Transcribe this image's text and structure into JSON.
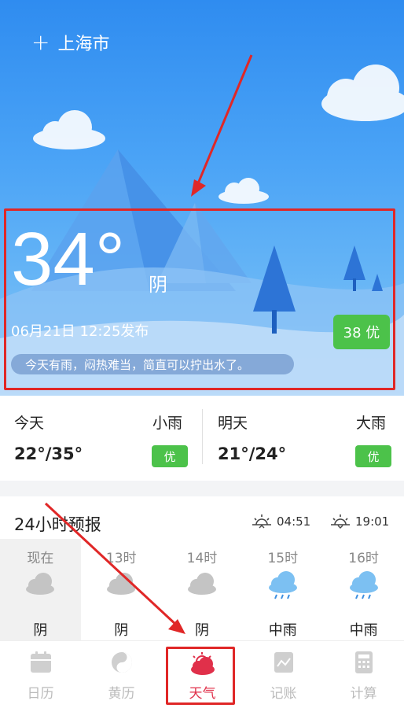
{
  "header": {
    "add_icon": "plus-icon",
    "city": "上海市"
  },
  "current": {
    "temperature": "34°",
    "condition": "阴",
    "published": "06月21日 12:25发布",
    "aqi": "38 优",
    "tip": "今天有雨，闷热难当，简直可以拧出水了。"
  },
  "days": [
    {
      "label": "今天",
      "weather": "小雨",
      "range": "22°/35°",
      "aqi": "优"
    },
    {
      "label": "明天",
      "weather": "大雨",
      "range": "21°/24°",
      "aqi": "优"
    }
  ],
  "hourly": {
    "title": "24小时预报",
    "sunrise": "04:51",
    "sunset": "19:01",
    "hours": [
      {
        "time": "现在",
        "condition": "阴",
        "icon": "cloud-icon"
      },
      {
        "time": "13时",
        "condition": "阴",
        "icon": "cloud-icon"
      },
      {
        "time": "14时",
        "condition": "阴",
        "icon": "cloud-icon"
      },
      {
        "time": "15时",
        "condition": "中雨",
        "icon": "rain-cloud-icon"
      },
      {
        "time": "16时",
        "condition": "中雨",
        "icon": "rain-cloud-icon"
      }
    ]
  },
  "tabs": [
    {
      "label": "日历",
      "icon": "calendar-icon"
    },
    {
      "label": "黄历",
      "icon": "yin-yang-icon"
    },
    {
      "label": "天气",
      "icon": "weather-icon",
      "active": true
    },
    {
      "label": "记账",
      "icon": "ledger-icon"
    },
    {
      "label": "计算",
      "icon": "calculator-icon"
    }
  ],
  "colors": {
    "accent": "#e0304a",
    "good": "#4cc24a",
    "annotation": "#e02727",
    "sky": "#2f8cf0"
  }
}
